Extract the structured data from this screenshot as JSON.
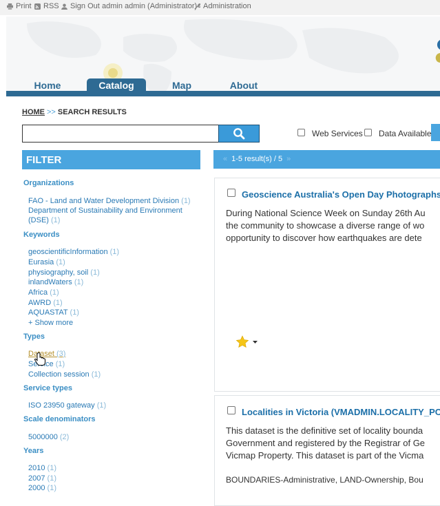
{
  "topbar": {
    "print": "Print",
    "rss": "RSS",
    "signout": "Sign Out",
    "user": "admin admin (Administrator)",
    "admin": "Administration"
  },
  "nav": {
    "home": "Home",
    "catalog": "Catalog",
    "map": "Map",
    "about": "About"
  },
  "breadcrumb": {
    "home": "HOME",
    "sep": ">>",
    "current": "SEARCH RESULTS"
  },
  "search": {
    "value": "",
    "web_services": "Web Services",
    "data_available": "Data Available"
  },
  "filter": {
    "title": "FILTER",
    "organizations": {
      "label": "Organizations",
      "items": [
        {
          "name": "FAO - Land and Water Development Division",
          "count": "(1)"
        },
        {
          "name": "Department of Sustainability and Environment (DSE)",
          "count": "(1)"
        }
      ]
    },
    "keywords": {
      "label": "Keywords",
      "items": [
        {
          "name": "geoscientificInformation",
          "count": "(1)"
        },
        {
          "name": "Eurasia",
          "count": "(1)"
        },
        {
          "name": "physiography, soil",
          "count": "(1)"
        },
        {
          "name": "inlandWaters",
          "count": "(1)"
        },
        {
          "name": "Africa",
          "count": "(1)"
        },
        {
          "name": "AWRD",
          "count": "(1)"
        },
        {
          "name": "AQUASTAT",
          "count": "(1)"
        }
      ],
      "show_more": "+ Show more"
    },
    "types": {
      "label": "Types",
      "items": [
        {
          "name": "Dataset",
          "count": "(3)"
        },
        {
          "name": "Service",
          "count": "(1)"
        },
        {
          "name": "Collection session",
          "count": "(1)"
        }
      ]
    },
    "service_types": {
      "label": "Service types",
      "items": [
        {
          "name": "ISO 23950 gateway",
          "count": "(1)"
        }
      ]
    },
    "scale": {
      "label": "Scale denominators",
      "items": [
        {
          "name": "5000000",
          "count": "(2)"
        }
      ]
    },
    "years": {
      "label": "Years",
      "items": [
        {
          "name": "2010",
          "count": "(1)"
        },
        {
          "name": "2007",
          "count": "(1)"
        },
        {
          "name": "2000",
          "count": "(1)"
        }
      ]
    }
  },
  "results": {
    "summary": "1-5 result(s) / 5",
    "prev": "«",
    "next": "»",
    "items": [
      {
        "title": "Geoscience Australia's Open Day Photographs",
        "lines": [
          "During National Science Week on Sunday 26th Au",
          "the community to showcase a diverse range of wo",
          "opportunity to discover how earthquakes are dete"
        ]
      },
      {
        "title": "Localities in Victoria (VMADMIN.LOCALITY_PO",
        "lines": [
          "This dataset is the definitive set of locality bounda",
          "Government and registered by the Registrar of Ge",
          "Vicmap Property. This dataset is part of the Vicma"
        ],
        "keywords": "BOUNDARIES-Administrative, LAND-Ownership, Bou"
      }
    ]
  },
  "colors": {
    "accent": "#4aa5df",
    "nav": "#2e6a93",
    "link": "#2a7ab5",
    "star": "#f5c518"
  }
}
